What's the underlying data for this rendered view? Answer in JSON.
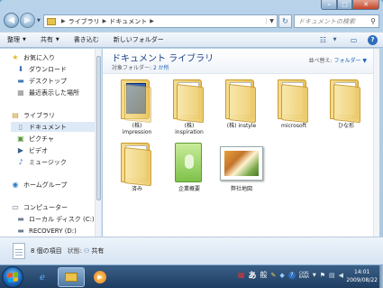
{
  "window": {
    "caption": {
      "minimize": "–",
      "maximize": "□",
      "close": "✕"
    }
  },
  "navbar": {
    "back_glyph": "◀",
    "forward_glyph": "▶",
    "breadcrumb": [
      "ライブラリ",
      "ドキュメント"
    ],
    "separator": "▶",
    "search_placeholder": "ドキュメントの検索",
    "refresh_glyph": "↻"
  },
  "toolbar": {
    "organize": "整理",
    "share": "共有",
    "burn": "書き込む",
    "new_folder": "新しいフォルダー",
    "help": "?"
  },
  "navpane": {
    "favorites": "お気に入り",
    "downloads": "ダウンロード",
    "desktop": "デスクトップ",
    "recent": "最近表示した場所",
    "libraries": "ライブラリ",
    "documents": "ドキュメント",
    "pictures": "ピクチャ",
    "videos": "ビデオ",
    "music": "ミュージック",
    "homegroup": "ホームグループ",
    "computer": "コンピューター",
    "local_disk": "ローカル ディスク (C:)",
    "recovery": "RECOVERY (D:)"
  },
  "content": {
    "title": "ドキュメント ライブラリ",
    "target_label": "対象フォルダー:",
    "target_value": "2 か所",
    "arrange_label": "並べ替え:",
    "arrange_value": "フォルダー",
    "items": [
      {
        "label": "(株)\nimpression",
        "kind": "folder-blue"
      },
      {
        "label": "(株)\ninspiration",
        "kind": "folder"
      },
      {
        "label": "(株) instyle",
        "kind": "folder"
      },
      {
        "label": "microsoft",
        "kind": "folder"
      },
      {
        "label": "ひな形",
        "kind": "folder"
      },
      {
        "label": "済み",
        "kind": "folder"
      },
      {
        "label": "企業概要",
        "kind": "green-doc"
      },
      {
        "label": "弊社地図",
        "kind": "photo"
      }
    ]
  },
  "details": {
    "count": "8 個の項目",
    "status_label": "状態:",
    "status_value": "共有"
  },
  "taskbar": {
    "ime_mode": "あ",
    "ime_kanji": "般",
    "caps_label": "CAPS\nKANA",
    "time": "14:01",
    "date": "2009/08/22"
  },
  "colors": {
    "accent": "#1a5fb4",
    "title": "#1a3f88",
    "taskbar": "#2a4a70"
  }
}
